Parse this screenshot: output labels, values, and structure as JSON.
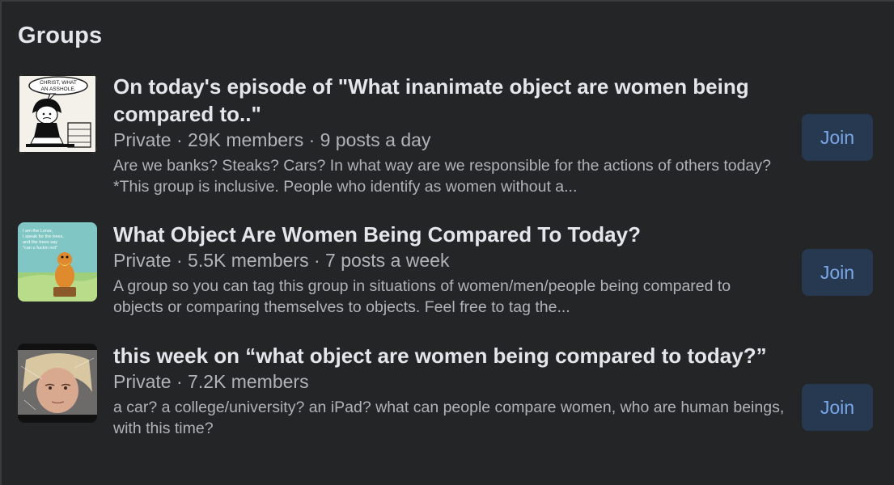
{
  "section": {
    "title": "Groups"
  },
  "groups": [
    {
      "name": "On today's episode of \"What inanimate object are women being compared to..\"",
      "privacy": "Private",
      "members": "29K members",
      "activity": "9 posts a day",
      "meta": "Private · 29K members · 9 posts a day",
      "description": "Are we banks? Steaks? Cars? In what way are we responsible for the actions of others today? *This group is inclusive. People who identify as women without a...",
      "thumbnail_caption": "CHRIST, WHAT AN ASSHOLE.",
      "thumbnail_icon": "comic-panel-image",
      "join_label": "Join"
    },
    {
      "name": "What Object Are Women Being Compared To Today?",
      "privacy": "Private",
      "members": "5.5K members",
      "activity": "7 posts a week",
      "meta": "Private · 5.5K members · 7 posts a week",
      "description": "A group so you can tag this group in situations of women/men/people being compared to objects or comparing themselves to objects. Feel free to tag the...",
      "thumbnail_caption": "I am the Lorax, I speak for the trees, and the trees say \"can u fuckin not\"",
      "thumbnail_icon": "lorax-image",
      "join_label": "Join"
    },
    {
      "name": "this week on “what object are women being compared to today?”",
      "privacy": "Private",
      "members": "7.2K members",
      "activity": "",
      "meta": "Private · 7.2K members",
      "description": "a car? a college/university? an iPad? what can people compare women, who are human beings, with this time?",
      "thumbnail_icon": "face-photo-image",
      "join_label": "Join"
    }
  ],
  "colors": {
    "panel_bg": "#242526",
    "primary_text": "#e4e6eb",
    "secondary_text": "#b0b3b8",
    "button_bg": "#263951",
    "button_text": "#7aa7e8"
  }
}
